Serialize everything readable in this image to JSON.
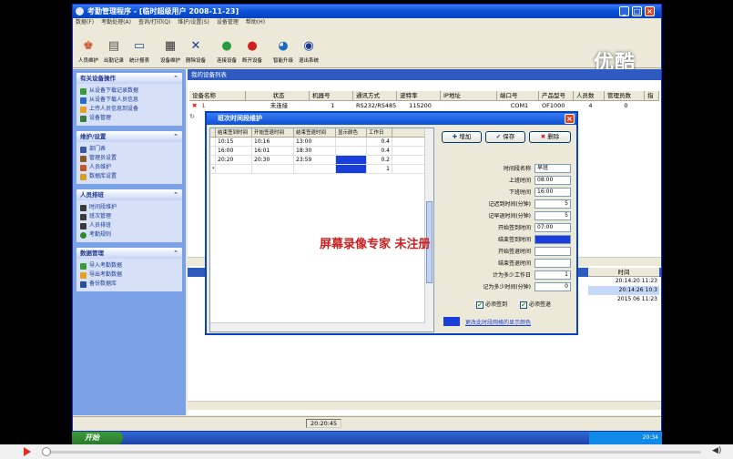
{
  "app": {
    "title": "考勤管理程序 - [临时超级用户 2008-11-23]"
  },
  "menu": [
    "数据(F)",
    "考勤处理(A)",
    "查询/打印(Q)",
    "维护/设置(S)",
    "设备管理",
    "帮助(H)"
  ],
  "toolbar": [
    "人员维护",
    "出勤记录",
    "统计报表",
    "设备维护",
    "删除设备",
    "连接设备",
    "断开设备",
    "智能升级",
    "退出系统"
  ],
  "logo": "优酷",
  "sidebar": {
    "panes": [
      {
        "title": "有关设备操作",
        "items": [
          "从设备下载记录数据",
          "从设备下载人员信息",
          "上传人员信息到设备",
          "设备管理"
        ]
      },
      {
        "title": "维护/设置",
        "items": [
          "部门表",
          "管理员设置",
          "人员维护",
          "数据库设置"
        ]
      },
      {
        "title": "人员排班",
        "items": [
          "时间段维护",
          "班次管理",
          "人员排班",
          "考勤规则"
        ]
      },
      {
        "title": "数据管理",
        "items": [
          "导入考勤数据",
          "导出考勤数据",
          "备份数据库"
        ]
      }
    ]
  },
  "content": {
    "header": "我的设备列表",
    "columns": [
      "设备名称",
      "状态",
      "机器号",
      "通讯方式",
      "波特率",
      "IP地址",
      "端口号",
      "产品型号",
      "人员数",
      "管理员数",
      "指"
    ],
    "row": [
      "1",
      "未连接",
      "1",
      "RS232/RS485",
      "115200",
      "",
      "COM1",
      "OF1000",
      "4",
      "0",
      ""
    ],
    "time_list": {
      "header": "时间",
      "rows": [
        "20:14:20 11:23",
        "20:14:26 10:3",
        "2015 06 11:23"
      ]
    },
    "status_time": "20:20:45"
  },
  "dialog": {
    "title": "班次时间段维护",
    "grid_columns": [
      "结束签到时间",
      "开始签退时间",
      "结束签退时间",
      "显示颜色",
      "工作日"
    ],
    "grid_rows": [
      [
        "10:15",
        "10:16",
        "13:00",
        "",
        "0.4"
      ],
      [
        "16:00",
        "16:01",
        "18:30",
        "",
        "0.4"
      ],
      [
        "20:20",
        "20:30",
        "23:59",
        "",
        "0.2"
      ],
      [
        "",
        "",
        "",
        "",
        "1"
      ]
    ],
    "buttons": {
      "add": "增加",
      "save": "保存",
      "delete": "删除"
    },
    "form": [
      {
        "label": "时间段名称",
        "value": "早班"
      },
      {
        "label": "上班时间",
        "value": "08:00"
      },
      {
        "label": "下班时间",
        "value": "16:00"
      },
      {
        "label": "记迟到时间(分钟)",
        "value": "5"
      },
      {
        "label": "记早退时间(分钟)",
        "value": "5"
      },
      {
        "label": "开始签到时间",
        "value": "07:00"
      },
      {
        "label": "结束签到时间",
        "value": ""
      },
      {
        "label": "开始签退时间",
        "value": ""
      },
      {
        "label": "结束签退时间",
        "value": ""
      },
      {
        "label": "计为多少工作日",
        "value": "1"
      },
      {
        "label": "记为多少时间(分钟)",
        "value": "0"
      }
    ],
    "checks": {
      "must_in": "必须签到",
      "must_out": "必须签退"
    },
    "color_link": "更改此时段网格的显示颜色",
    "overlay": "屏幕录像专家  未注册"
  },
  "taskbar": {
    "start": "开始",
    "tray_time": "20:34"
  },
  "colors": {
    "accent": "#0a50d8",
    "dialog_cell": "#1a3fd8"
  }
}
